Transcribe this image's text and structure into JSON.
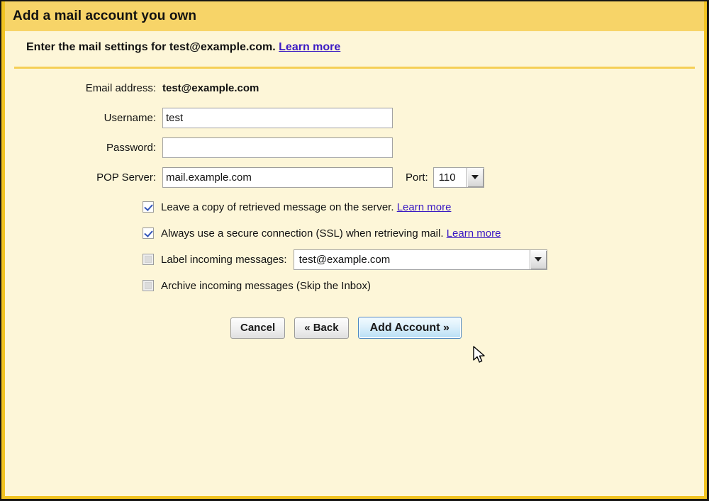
{
  "dialog": {
    "title": "Add a mail account you own",
    "subtitle_prefix": "Enter the mail settings for test@example.com.",
    "subtitle_link": "Learn more"
  },
  "form": {
    "email_label": "Email address:",
    "email_value": "test@example.com",
    "username_label": "Username:",
    "username_value": "test",
    "username_placeholder": "",
    "password_label": "Password:",
    "password_value": "",
    "password_placeholder": "",
    "pop_label": "POP Server:",
    "pop_value": "mail.example.com",
    "pop_placeholder": "",
    "port_label": "Port:",
    "port_value": "110"
  },
  "options": {
    "leave_copy": {
      "label": "Leave a copy of retrieved message on the server.",
      "link": "Learn more",
      "checked": true
    },
    "ssl": {
      "label": "Always use a secure connection (SSL) when retrieving mail.",
      "link": "Learn more",
      "checked": true
    },
    "label_incoming": {
      "label": "Label incoming messages:",
      "value": "test@example.com",
      "checked": false
    },
    "archive_incoming": {
      "label": "Archive incoming messages (Skip the Inbox)",
      "checked": false
    }
  },
  "buttons": {
    "cancel": "Cancel",
    "back": "« Back",
    "submit": "Add Account »"
  },
  "colors": {
    "titlebar": "#f7d468",
    "body": "#fdf6d8",
    "border_gold": "#f2c422",
    "link": "#3a19c4",
    "primary_button_border": "#4b86c2",
    "checkmark": "#3355b8"
  },
  "icons": {
    "dropdown": "chevron-down-icon",
    "cursor": "mouse-pointer-icon"
  }
}
